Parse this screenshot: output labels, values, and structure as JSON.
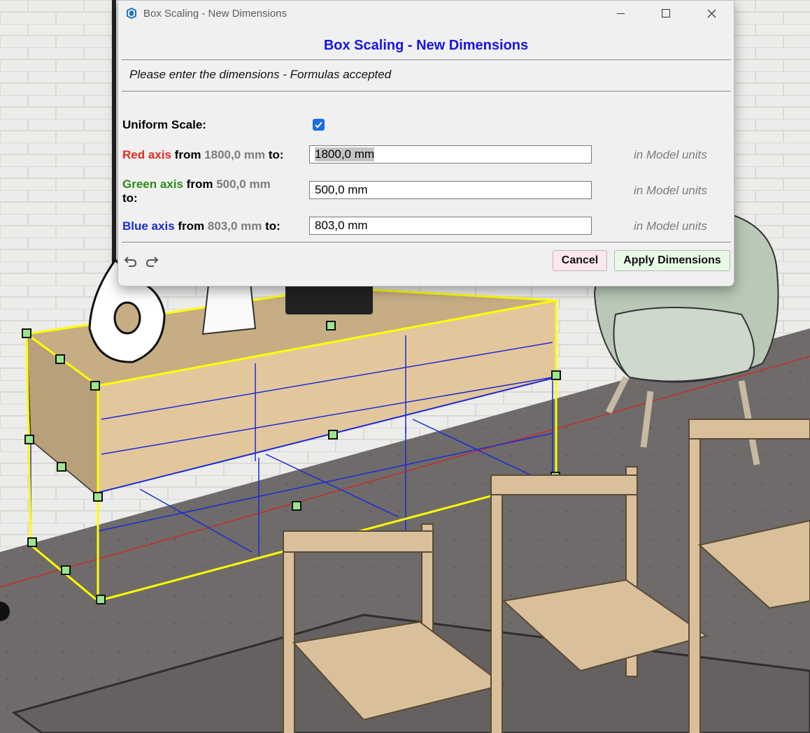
{
  "window": {
    "title": "Box Scaling - New Dimensions"
  },
  "header": {
    "title": "Box Scaling - New Dimensions",
    "subtitle": "Please enter the dimensions - Formulas accepted"
  },
  "uniform": {
    "label": "Uniform Scale:",
    "checked": true
  },
  "axes": [
    {
      "name": "Red axis",
      "from_word": " from ",
      "from_value": "1800,0 mm",
      "to_word": " to:",
      "value": "1800,0 mm",
      "units": "in Model units",
      "color": "#e02a1e"
    },
    {
      "name": "Green axis",
      "from_word": " from ",
      "from_value": "500,0 mm",
      "to_word": "to:",
      "value": "500,0 mm",
      "units": "in Model units",
      "color": "#2c8a17"
    },
    {
      "name": "Blue axis",
      "from_word": " from ",
      "from_value": "803,0 mm",
      "to_word": " to:",
      "value": "803,0 mm",
      "units": "in Model units",
      "color": "#1a2ad8"
    }
  ],
  "footer": {
    "cancel_label": "Cancel",
    "apply_label": "Apply Dimensions"
  },
  "colors": {
    "accent": "#1515e6",
    "selection_box": "#ffff00",
    "wireframe": "#1a2ad8"
  },
  "icons": [
    "sketchup-icon",
    "minimize-icon",
    "maximize-icon",
    "close-icon",
    "undo-icon",
    "redo-icon",
    "checkmark-icon"
  ]
}
